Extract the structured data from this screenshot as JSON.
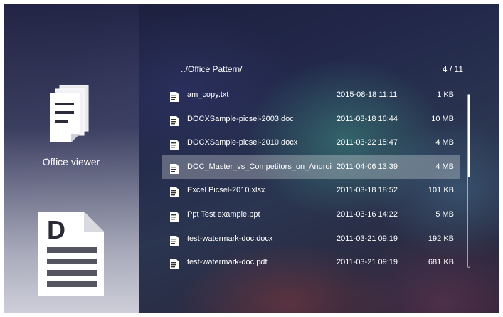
{
  "sidebar": {
    "app_icon": "office-documents-icon",
    "app_label": "Office viewer",
    "type_icon": "word-document-icon",
    "type_icon_letter": "D"
  },
  "browser": {
    "path": "../Office Pattern/",
    "counter": "4 / 11",
    "file_icon": "document-file-icon",
    "files": [
      {
        "name": "am_copy.txt",
        "date": "2015-08-18 11:11",
        "size": "1 KB"
      },
      {
        "name": "DOCXSample-picsel-2003.doc",
        "date": "2011-03-18 16:44",
        "size": "10 MB"
      },
      {
        "name": "DOCXSample-picsel-2010.docx",
        "date": "2011-03-22 15:47",
        "size": "4 MB"
      },
      {
        "name": "DOC_Master_vs_Competitors_on_Androi",
        "date": "2011-04-06 13:39",
        "size": "4 MB"
      },
      {
        "name": "Excel Picsel-2010.xlsx",
        "date": "2011-03-18 18:52",
        "size": "101 KB"
      },
      {
        "name": "Ppt Test example.ppt",
        "date": "2011-03-16 14:22",
        "size": "5 MB"
      },
      {
        "name": "test-watermark-doc.docx",
        "date": "2011-03-21 09:19",
        "size": "192 KB"
      },
      {
        "name": "test-watermark-doc.pdf",
        "date": "2011-03-21 09:19",
        "size": "681 KB"
      }
    ],
    "selected_index": 3
  },
  "colors": {
    "text": "#ffffff",
    "selection": "rgba(255,255,255,0.28)"
  }
}
